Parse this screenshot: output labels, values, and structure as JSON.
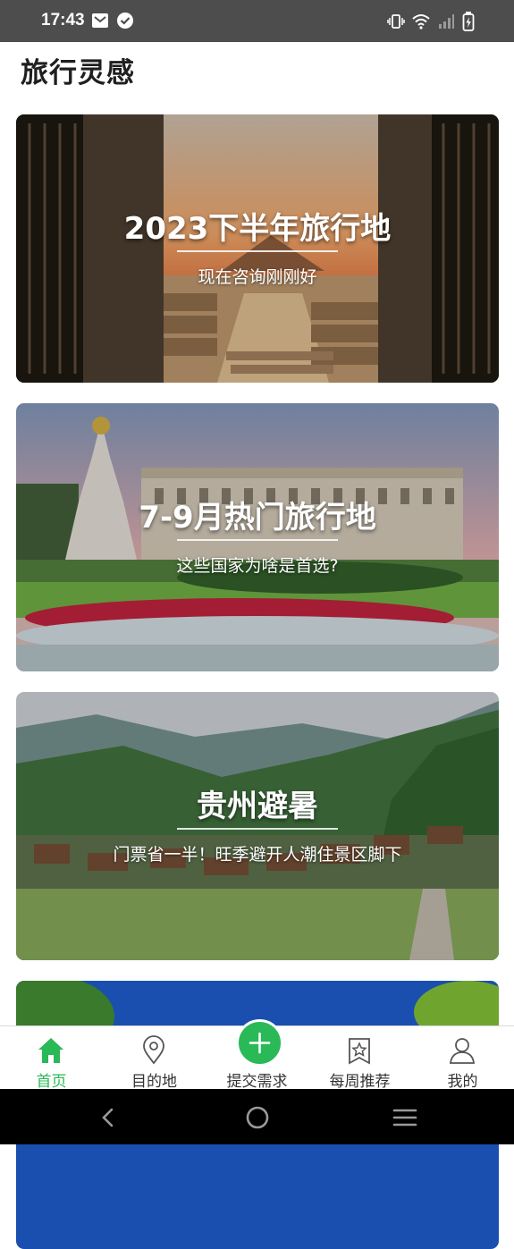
{
  "status_bar": {
    "time": "17:43",
    "left_icons": [
      "mail-icon",
      "check-circle-icon"
    ],
    "right_icons": [
      "vibrate-icon",
      "wifi-icon",
      "signal-icon",
      "battery-charging-icon"
    ]
  },
  "page": {
    "title": "旅行灵感"
  },
  "cards": [
    {
      "title": "2023下半年旅行地",
      "subtitle": "现在咨询刚刚好",
      "scene": "desert-gate"
    },
    {
      "title": "7-9月热门旅行地",
      "subtitle": "这些国家为啥是首选?",
      "scene": "palace-garden"
    },
    {
      "title": "贵州避暑",
      "subtitle": "门票省一半！旺季避开人潮住景区脚下",
      "scene": "mountain-village"
    },
    {
      "title": "",
      "subtitle": "",
      "scene": "blue-sky-trees"
    }
  ],
  "tab_bar": {
    "tabs": [
      {
        "label": "首页",
        "icon": "home-icon",
        "active": true
      },
      {
        "label": "目的地",
        "icon": "location-pin-icon",
        "active": false
      },
      {
        "label": "提交需求",
        "icon": "plus-icon",
        "active": false
      },
      {
        "label": "每周推荐",
        "icon": "star-bookmark-icon",
        "active": false
      },
      {
        "label": "我的",
        "icon": "user-icon",
        "active": false
      }
    ]
  },
  "colors": {
    "accent": "#2ab957",
    "status_bar": "#4d4d4d",
    "nav_bar": "#000000"
  }
}
